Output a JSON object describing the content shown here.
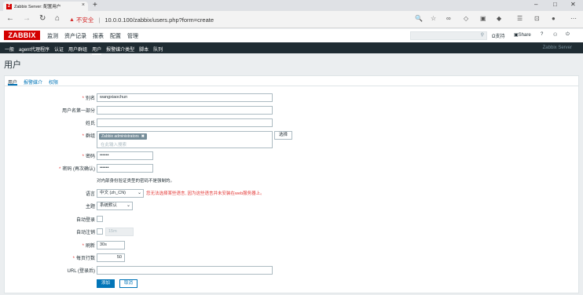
{
  "browser": {
    "tab_title": "Zabbix Server: 配置用户",
    "tab_favicon": "Z",
    "close_glyph": "×",
    "new_tab_glyph": "+",
    "not_secure": "不安全",
    "url": "10.0.0.100/zabbix/users.php?form=create"
  },
  "header": {
    "logo": "ZABBIX",
    "menu": [
      "监测",
      "资产记录",
      "报表",
      "配置",
      "管理"
    ],
    "support": "支持",
    "share": "Share",
    "help": "?",
    "user_icon": "person-icon",
    "power_icon": "power-icon"
  },
  "submenu": {
    "items": [
      "一般",
      "agent代理程序",
      "认证",
      "用户群组",
      "用户",
      "报警媒介类型",
      "脚本",
      "队列"
    ],
    "active_index": 4,
    "server_name": "Zabbix Server"
  },
  "page": {
    "title": "用户",
    "tabs": [
      "用户",
      "报警媒介",
      "权限"
    ],
    "active_tab": 0
  },
  "form": {
    "alias": {
      "label": "别名",
      "value": "wangxiaochun"
    },
    "name": {
      "label": "用户名第一部分",
      "value": ""
    },
    "surname": {
      "label": "姓氏",
      "value": ""
    },
    "groups": {
      "label": "群组",
      "chip": "Zabbix administrators",
      "chip_remove": "✖",
      "placeholder": "在此输入搜索",
      "select_button": "选择"
    },
    "password": {
      "label": "密码",
      "value": "••••••"
    },
    "password_confirm": {
      "label": "密码 (再次确认)",
      "value": "••••••"
    },
    "password_note": "对内部身份验证类型的密码不是强制的。",
    "language": {
      "label": "语言",
      "value": "中文 (zh_CN)",
      "error": "您无法选择某些语言, 因为这些语言并未安装在web服务器上。"
    },
    "theme": {
      "label": "主题",
      "value": "系统默认"
    },
    "autologin": {
      "label": "自动登录"
    },
    "autologout": {
      "label": "自动注销",
      "value": "15m"
    },
    "refresh": {
      "label": "刷新",
      "value": "30s"
    },
    "rows_per_page": {
      "label": "每页行数",
      "value": "50"
    },
    "url": {
      "label": "URL (登录后)",
      "value": ""
    },
    "add_button": "添加",
    "cancel_button": "取消"
  },
  "colors": {
    "brand": "#d40000",
    "nav_dark": "#1f2c33",
    "link": "#0275b8",
    "error": "#e33734"
  }
}
